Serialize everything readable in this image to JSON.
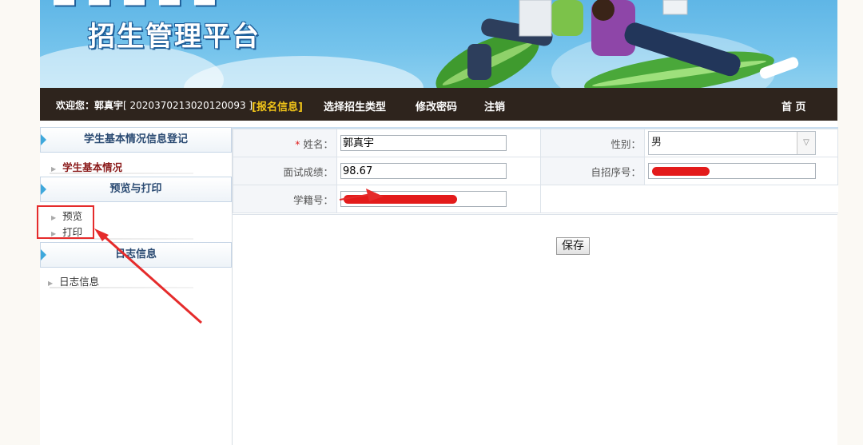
{
  "banner": {
    "title": "招生管理平台"
  },
  "navbar": {
    "welcome_prefix": "欢迎您：",
    "user_name": "郭真宇",
    "user_id": "[ 2020370213020120093 ]",
    "current_tag": "[报名信息]",
    "items": [
      "选择招生类型",
      "修改密码",
      "注销"
    ],
    "home": "首 页"
  },
  "sidebar": {
    "sections": [
      {
        "title": "学生基本情况信息登记",
        "items": [
          "学生基本情况"
        ]
      },
      {
        "title": "预览与打印",
        "items": [
          "预览",
          "打印"
        ]
      },
      {
        "title": "日志信息",
        "items": [
          "日志信息"
        ]
      }
    ]
  },
  "form": {
    "name_label": "姓名：",
    "name_required_mark": "*",
    "name_value": "郭真宇",
    "gender_label": "性别：",
    "gender_value": "男",
    "score_label": "面试成绩：",
    "score_value": "98.67",
    "self_no_label": "自招序号：",
    "student_no_label": "学籍号：",
    "save_label": "保存"
  },
  "colors": {
    "nav_bg": "#2e241d",
    "nav_current": "#f0c419",
    "annotation_red": "#e52b2b",
    "accent_blue": "#3ea8dc"
  }
}
